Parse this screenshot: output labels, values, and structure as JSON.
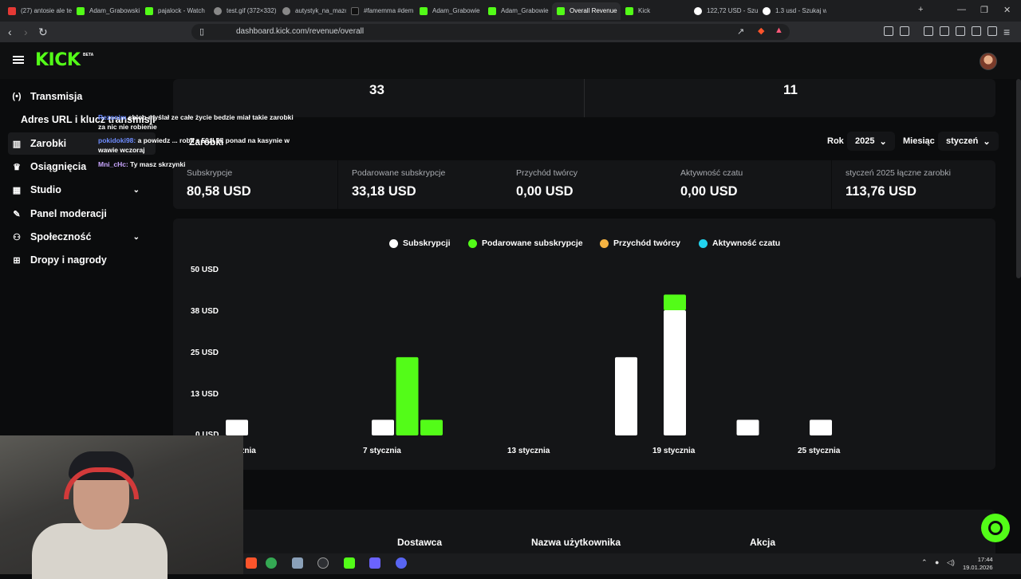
{
  "browser": {
    "tabs": [
      {
        "label": "(27) antosie ale te",
        "icon": "youtube"
      },
      {
        "label": "Adam_Grabowski",
        "icon": "kick"
      },
      {
        "label": "pajalock - Watch",
        "icon": "kick"
      },
      {
        "label": "test.gif (372×332)",
        "icon": "globe"
      },
      {
        "label": "autystyk_na_mazo",
        "icon": "globe"
      },
      {
        "label": "#famemma #dem",
        "icon": "tiktok"
      },
      {
        "label": "Adam_Grabowie",
        "icon": "kick"
      },
      {
        "label": "Adam_Grabowie",
        "icon": "kick"
      },
      {
        "label": "Overall Revenue",
        "icon": "kick",
        "active": true
      },
      {
        "label": "Kick",
        "icon": "kick"
      },
      {
        "label": "122,72 USD - Szu",
        "icon": "google"
      },
      {
        "label": "1.3 usd - Szukaj w",
        "icon": "google"
      }
    ],
    "url": "dashboard.kick.com/revenue/overall"
  },
  "app": {
    "logo": "KICK",
    "logo_badge": "BETA"
  },
  "sidebar": {
    "items": [
      {
        "label": "Transmisja",
        "icon": "broadcast-icon",
        "glyph": "(•)"
      },
      {
        "label": "Zarobki",
        "icon": "chart-icon",
        "glyph": "▥",
        "active": true
      },
      {
        "label": "Osiągnięcia",
        "icon": "trophy-icon",
        "glyph": "🏆"
      },
      {
        "label": "Studio",
        "icon": "studio-icon",
        "glyph": "▦",
        "expandable": true
      },
      {
        "label": "Panel moderacji",
        "icon": "wrench-icon",
        "glyph": "✎"
      },
      {
        "label": "Społeczność",
        "icon": "community-icon",
        "glyph": "⚇",
        "expandable": true
      },
      {
        "label": "Dropy i nagrody",
        "icon": "gift-icon",
        "glyph": "⊞"
      }
    ],
    "sub_item": "Adres URL i klucz transmisji",
    "overlay_label": "Zarobki"
  },
  "summary": {
    "left_value": "33",
    "right_value": "11"
  },
  "filters": {
    "year_label": "Rok",
    "year_value": "2025",
    "month_label": "Miesiąc",
    "month_value": "styczeń"
  },
  "stats": [
    {
      "title": "Subskrypcje",
      "value": "80,58 USD"
    },
    {
      "title": "Podarowane subskrypcje",
      "value": "33,18 USD"
    },
    {
      "title": "Przychód twórcy",
      "value": "0,00 USD"
    },
    {
      "title": "Aktywność czatu",
      "value": "0,00 USD"
    },
    {
      "title": "styczeń 2025 łączne zarobki",
      "value": "113,76 USD"
    }
  ],
  "chart_data": {
    "type": "bar",
    "stacked": true,
    "series": [
      {
        "name": "Subskrypcji",
        "color": "#ffffff"
      },
      {
        "name": "Podarowane subskrypcje",
        "color": "#53fc18"
      },
      {
        "name": "Przychód twórcy",
        "color": "#f5b342"
      },
      {
        "name": "Aktywność czatu",
        "color": "#22d3ee"
      }
    ],
    "y_ticks": [
      "50 USD",
      "38 USD",
      "25 USD",
      "13 USD",
      "0 USD"
    ],
    "ylim": [
      0,
      50
    ],
    "x_ticks": [
      {
        "label": "1 stycznia",
        "day": 1
      },
      {
        "label": "7 stycznia",
        "day": 7
      },
      {
        "label": "13 stycznia",
        "day": 13
      },
      {
        "label": "19 stycznia",
        "day": 19
      },
      {
        "label": "25 stycznia",
        "day": 25
      }
    ],
    "bars": [
      {
        "day": 1,
        "series": "Subskrypcji",
        "base": 0,
        "value": 4.74
      },
      {
        "day": 7,
        "series": "Subskrypcji",
        "base": 0,
        "value": 4.74
      },
      {
        "day": 8,
        "series": "Podarowane subskrypcje",
        "base": 0,
        "value": 23.7
      },
      {
        "day": 9,
        "series": "Podarowane subskrypcje",
        "base": 0,
        "value": 4.74
      },
      {
        "day": 17,
        "series": "Subskrypcji",
        "base": 0,
        "value": 23.7
      },
      {
        "day": 19,
        "series": "Subskrypcji",
        "base": 0,
        "value": 37.92
      },
      {
        "day": 19,
        "series": "Podarowane subskrypcje",
        "base": 37.92,
        "value": 4.74
      },
      {
        "day": 22,
        "series": "Subskrypcji",
        "base": 0,
        "value": 4.74
      },
      {
        "day": 25,
        "series": "Subskrypcji",
        "base": 0,
        "value": 4.74
      }
    ],
    "legend_position": "top"
  },
  "chat": [
    {
      "user": "Rezonim",
      "text": "chlop myślał ze całe życie bedzie miał takie zarobki za nic nie robienie"
    },
    {
      "user": "pokidoki98:",
      "text": "a powiedz ... robil z 50zl 2k ponad na kasynie w wawie wczoraj"
    },
    {
      "user": "Mni_cHc:",
      "text": "Ty masz skrzynki"
    }
  ],
  "table_headers": [
    "Dostawca",
    "Nazwa użytkownika",
    "Akcja"
  ],
  "taskbar": {
    "time": "17:44",
    "date": "19.01.2026"
  }
}
